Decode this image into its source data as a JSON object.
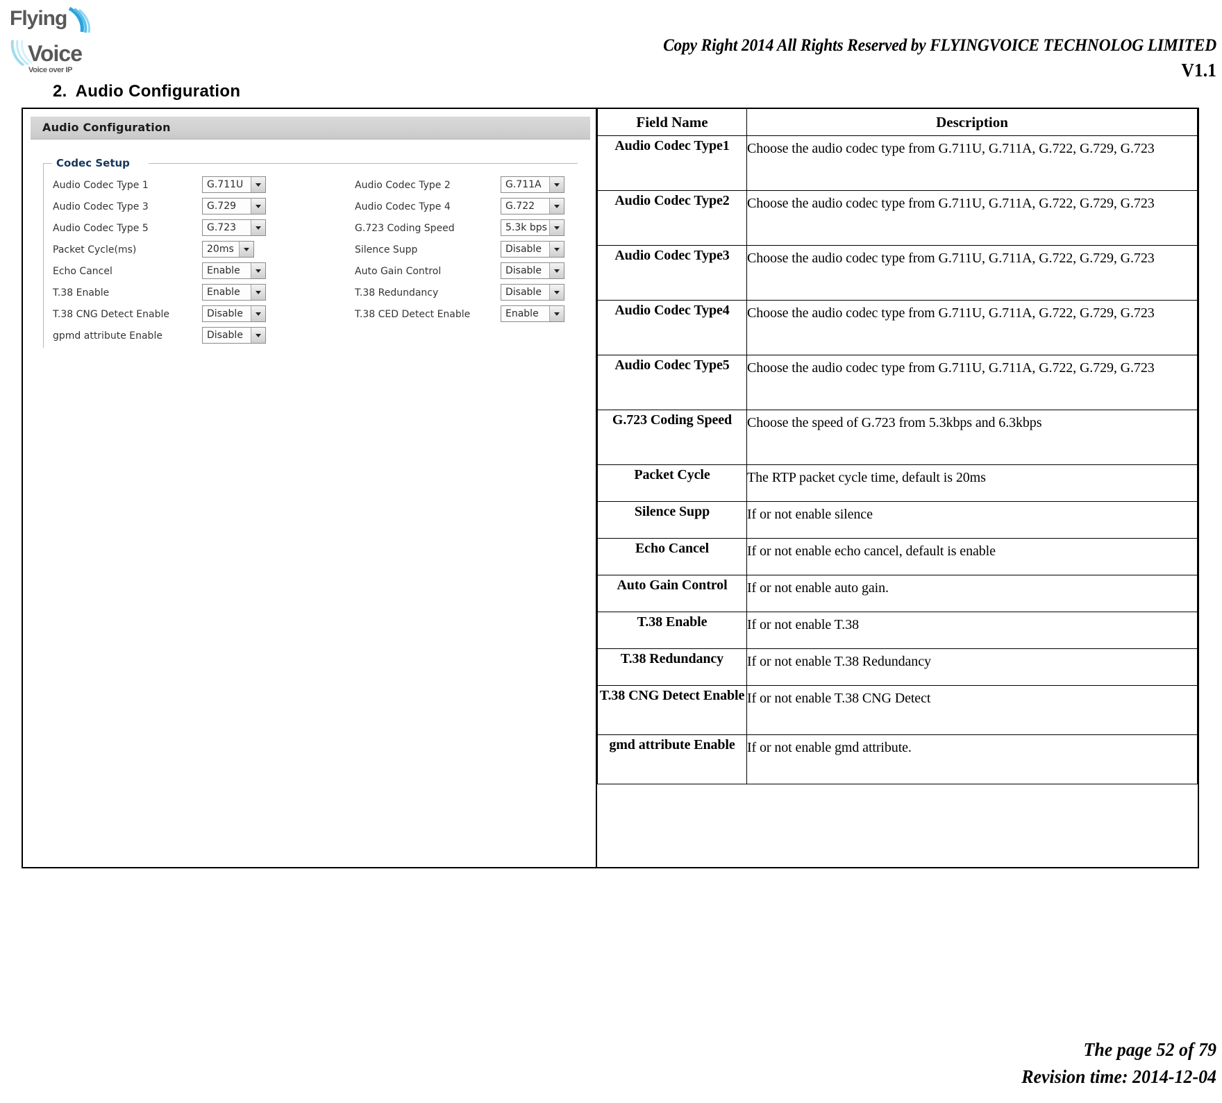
{
  "header": {
    "logo_alt": "Flying Voice",
    "logo_line1": "Flying",
    "logo_line2": "Voice",
    "logo_tagline": "Voice over IP",
    "copyright": "Copy Right 2014 All Rights Reserved by FLYINGVOICE TECHNOLOG LIMITED",
    "version": "V1.1"
  },
  "section": {
    "number": "2.",
    "title": "Audio Configuration"
  },
  "screenshot": {
    "window_title": "Audio Configuration",
    "fieldset_legend": "Codec Setup",
    "rows": [
      {
        "left_label": "Audio Codec Type 1",
        "left_value": "G.711U",
        "right_label": "Audio Codec Type 2",
        "right_value": "G.711A"
      },
      {
        "left_label": "Audio Codec Type 3",
        "left_value": "G.729",
        "right_label": "Audio Codec Type 4",
        "right_value": "G.722"
      },
      {
        "left_label": "Audio Codec Type 5",
        "left_value": "G.723",
        "right_label": "G.723 Coding Speed",
        "right_value": "5.3k bps"
      },
      {
        "left_label": "Packet Cycle(ms)",
        "left_value": "20ms",
        "right_label": "Silence Supp",
        "right_value": "Disable"
      },
      {
        "left_label": "Echo Cancel",
        "left_value": "Enable",
        "right_label": "Auto Gain Control",
        "right_value": "Disable"
      },
      {
        "left_label": "T.38 Enable",
        "left_value": "Enable",
        "right_label": "T.38 Redundancy",
        "right_value": "Disable"
      },
      {
        "left_label": "T.38 CNG Detect Enable",
        "left_value": "Disable",
        "right_label": "T.38 CED Detect Enable",
        "right_value": "Enable"
      },
      {
        "left_label": "gpmd attribute Enable",
        "left_value": "Disable",
        "right_label": "",
        "right_value": ""
      }
    ],
    "dropdown_icon": "chevron-down-icon"
  },
  "table": {
    "headers": [
      "Field Name",
      "Description"
    ],
    "rows": [
      {
        "field": "Audio Codec Type1",
        "description": "Choose the audio codec type from G.711U, G.711A, G.722, G.729, G.723"
      },
      {
        "field": "Audio Codec Type2",
        "description": "Choose the audio codec type from G.711U, G.711A, G.722, G.729, G.723"
      },
      {
        "field": "Audio Codec Type3",
        "description": "Choose the audio codec type from G.711U, G.711A, G.722, G.729, G.723"
      },
      {
        "field": "Audio Codec Type4",
        "description": "Choose the audio codec type from G.711U, G.711A, G.722, G.729, G.723"
      },
      {
        "field": "Audio Codec Type5",
        "description": "Choose the audio codec type from G.711U, G.711A, G.722, G.729, G.723"
      },
      {
        "field": "G.723 Coding Speed",
        "description": "Choose the speed of G.723 from 5.3kbps and 6.3kbps"
      },
      {
        "field": "Packet Cycle",
        "description": "The RTP packet cycle time, default is 20ms"
      },
      {
        "field": "Silence Supp",
        "description": "If or not enable silence"
      },
      {
        "field": "Echo Cancel",
        "description": "If or not enable echo cancel, default is enable"
      },
      {
        "field": "Auto Gain Control",
        "description": "If or not enable auto gain."
      },
      {
        "field": "T.38 Enable",
        "description": "If or not enable T.38"
      },
      {
        "field": "T.38 Redundancy",
        "description": "If or not enable T.38 Redundancy"
      },
      {
        "field": "T.38 CNG Detect Enable",
        "description": "If or not enable T.38 CNG Detect"
      },
      {
        "field": "gmd attribute Enable",
        "description": "If or not enable gmd attribute."
      }
    ]
  },
  "footer": {
    "page": "The page 52 of 79",
    "revision": "Revision time: 2014-12-04"
  },
  "colors": {
    "legend_blue": "#17365d",
    "titlebar_gray": "#d2d2d2",
    "logo_blue": "#29a3dd",
    "logo_gray": "#58585a"
  }
}
